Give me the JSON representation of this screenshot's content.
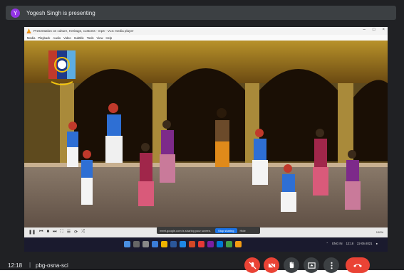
{
  "meet": {
    "avatar_letter": "Y",
    "presenting_text": "Yogesh Singh is presenting",
    "clock": "12:18",
    "separator": "|",
    "meeting_code": "pbg-osna-sci"
  },
  "vlc": {
    "title": "Presentation on culture, Heritage, customs - mp4 - VLC media player",
    "menu": [
      "Media",
      "Playback",
      "Audio",
      "Video",
      "Subtitle",
      "Tools",
      "View",
      "Help"
    ],
    "time_elapsed": "07:10",
    "time_total": "26:00",
    "progress": 0.28,
    "volume": "100%"
  },
  "share_bar": {
    "message": "meet.google.com is sharing your screen.",
    "stop_label": "Stop sharing",
    "hide_label": "Hide"
  },
  "taskbar": {
    "tray_lang": "ENG IN",
    "tray_time": "12:18",
    "tray_date": "22-06-2021"
  },
  "colors": {
    "end_call": "#ea4335",
    "meet_bg": "#202124",
    "accent": "#1a73e8"
  }
}
